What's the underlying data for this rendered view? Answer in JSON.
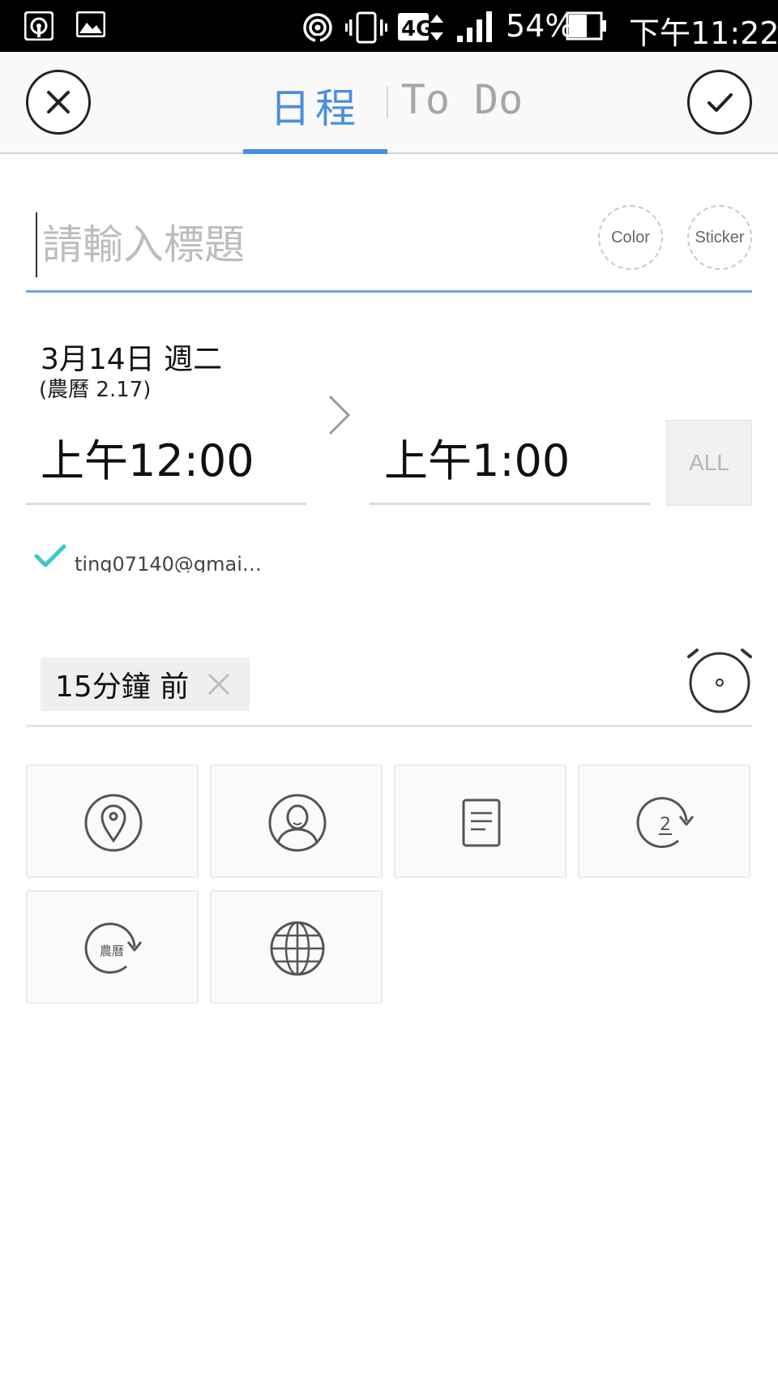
{
  "status_bar": {
    "signal_type": "4G",
    "battery": "54%",
    "time": "下午11:22",
    "icons": [
      "hotspot-icon",
      "gallery-icon",
      "wifi-tethering-icon",
      "vibrate-icon",
      "mobile-data-icon",
      "signal-icon",
      "battery-icon"
    ]
  },
  "header": {
    "tabs": [
      {
        "label": "日程",
        "active": true
      },
      {
        "label": "To Do",
        "active": false
      }
    ],
    "accent_color": "#4a8ee0"
  },
  "title_field": {
    "placeholder": "請輸入標題",
    "value": ""
  },
  "color_button": {
    "label": "Color"
  },
  "sticker_button": {
    "label": "Sticker"
  },
  "date": {
    "main": "3月14日  週二",
    "lunar": "(農曆  2.17)"
  },
  "start_time": "上午12:00",
  "end_time": "上午1:00",
  "all_day_button": {
    "label": "ALL"
  },
  "account": {
    "email": "ting07140@gmai…",
    "checked": true,
    "check_color": "#3cc8c8"
  },
  "reminder": {
    "label": "15分鐘 前"
  },
  "options": [
    {
      "icon": "location-pin-icon"
    },
    {
      "icon": "person-icon"
    },
    {
      "icon": "note-icon"
    },
    {
      "icon": "repeat-icon",
      "badge": "2"
    },
    {
      "icon": "lunar-repeat-icon",
      "badge": "農曆"
    },
    {
      "icon": "globe-icon"
    }
  ]
}
